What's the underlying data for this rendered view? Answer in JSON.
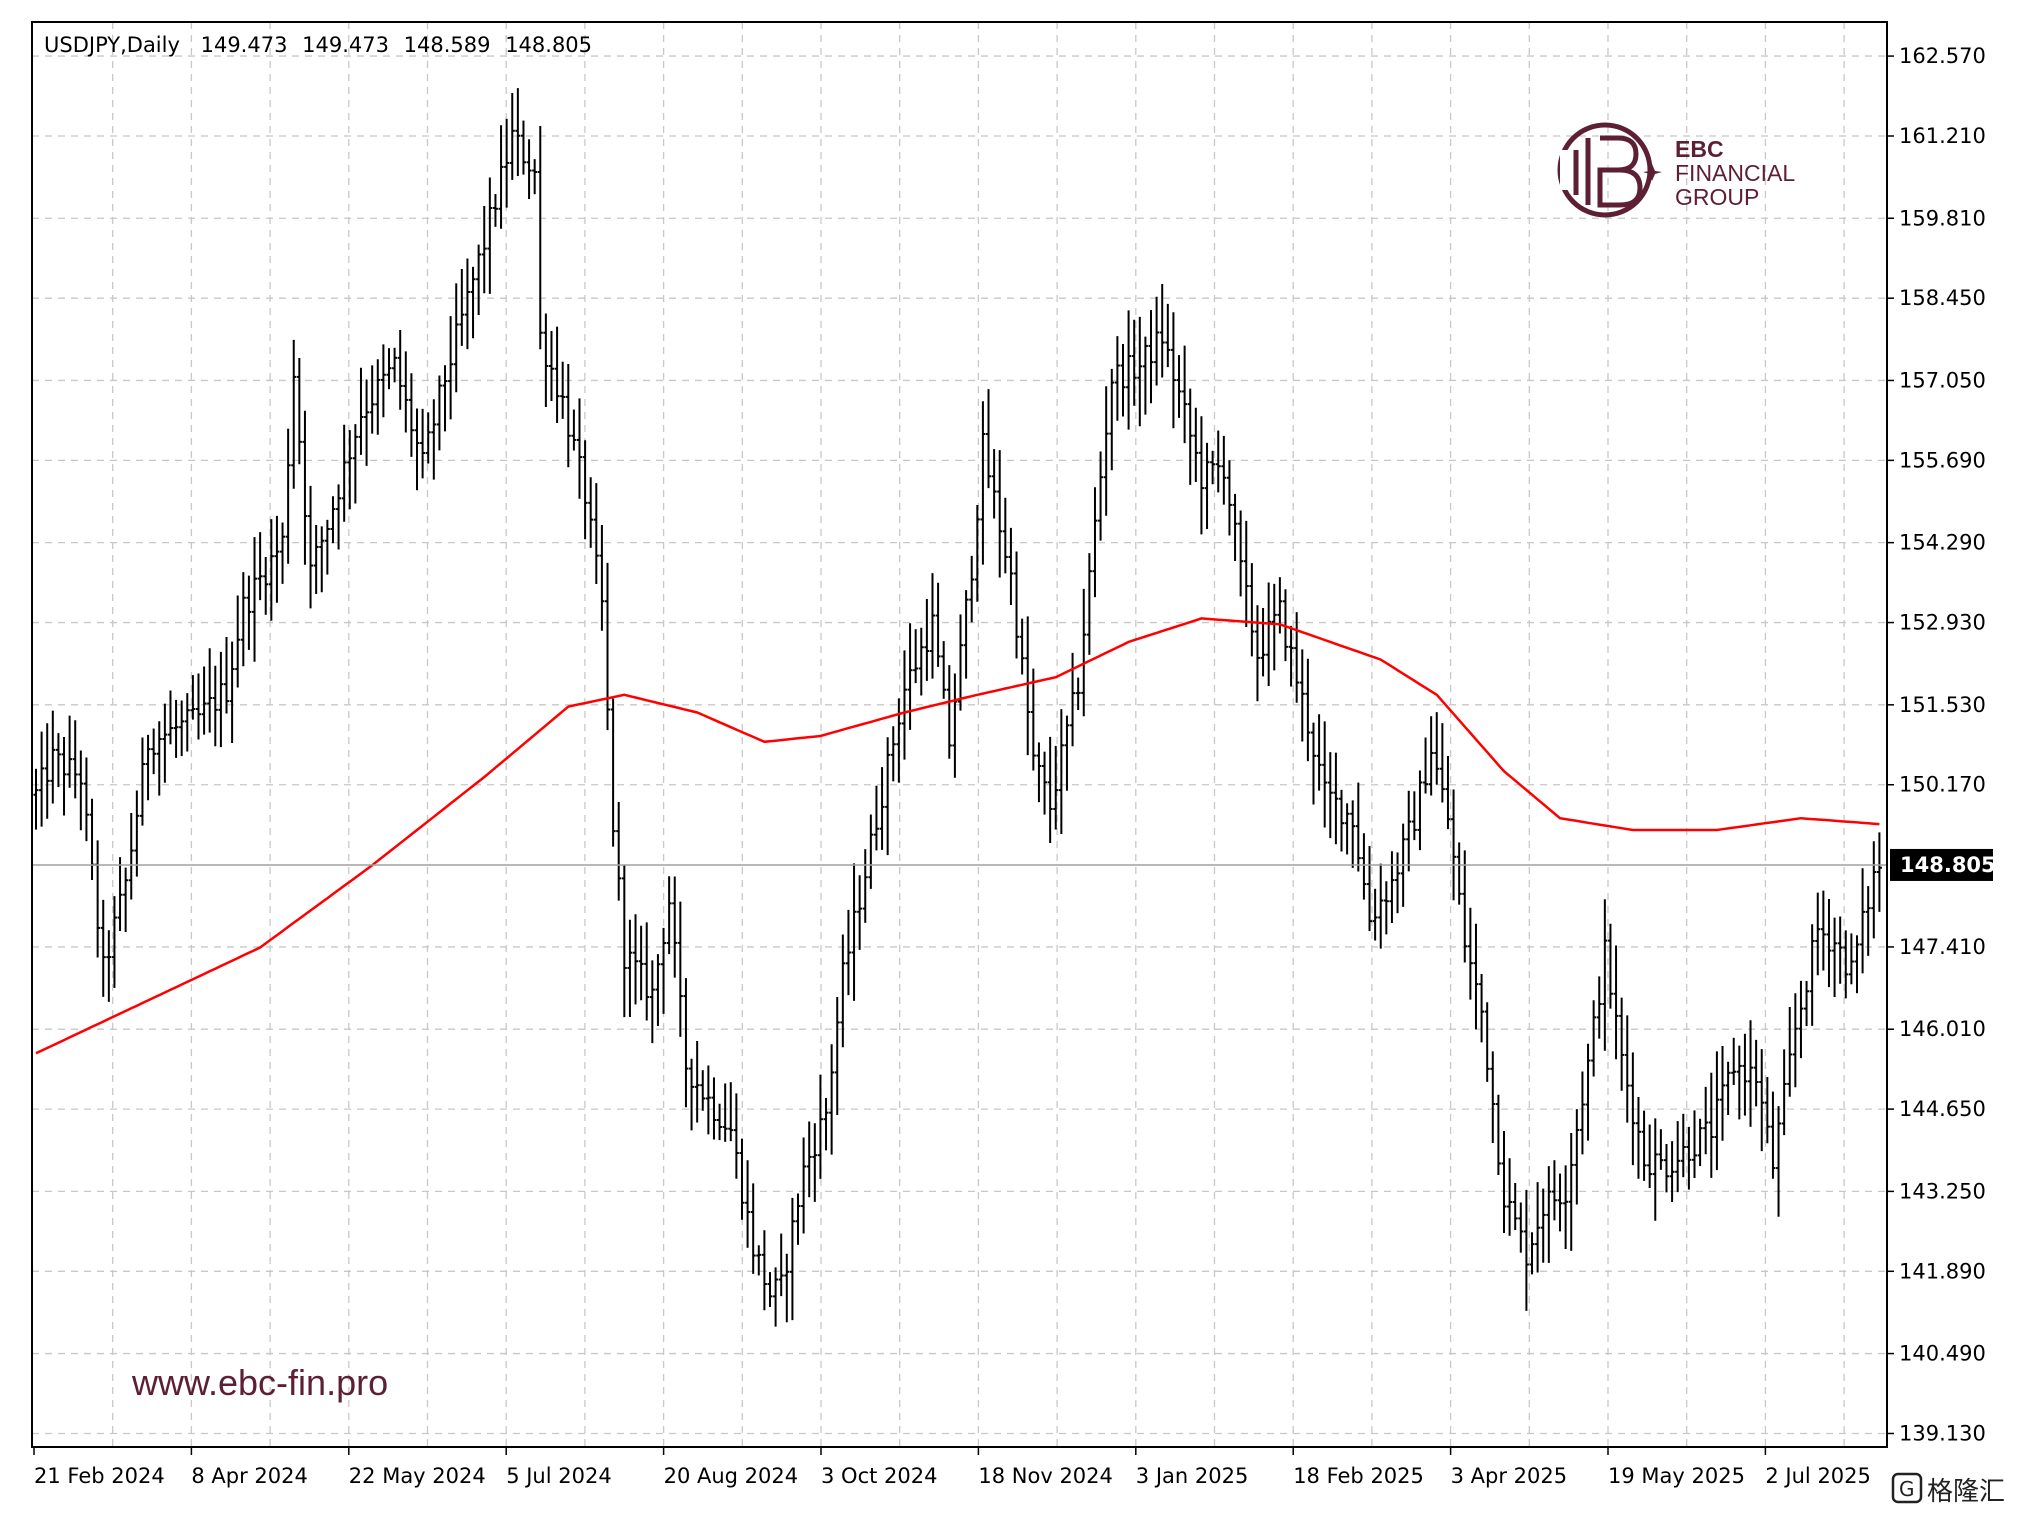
{
  "chart_data": {
    "type": "ohlc",
    "symbol_header": "USDJPY,Daily",
    "header_ohlc": [
      "149.473",
      "149.473",
      "148.589",
      "148.805"
    ],
    "last_price": "148.805",
    "y_ticks": [
      "162.570",
      "161.210",
      "159.810",
      "158.450",
      "157.050",
      "155.690",
      "154.290",
      "152.930",
      "151.530",
      "150.170",
      "147.410",
      "146.010",
      "144.650",
      "143.250",
      "141.890",
      "140.490",
      "139.130"
    ],
    "x_ticks": [
      "21 Feb 2024",
      "8 Apr 2024",
      "22 May 2024",
      "5 Jul 2024",
      "20 Aug 2024",
      "3 Oct 2024",
      "18 Nov 2024",
      "3 Jan 2025",
      "18 Feb 2025",
      "3 Apr 2025",
      "19 May 2025",
      "2 Jul 2025"
    ],
    "ylim": [
      138.9,
      163.15
    ],
    "grid": true,
    "series": [
      {
        "name": "",
        "color": "#000000",
        "kind": "bars"
      },
      {
        "name": "",
        "color": "#ff0000",
        "kind": "moving-average"
      }
    ],
    "price_path": [
      [
        0,
        150.0
      ],
      [
        3,
        150.6
      ],
      [
        8,
        150.3
      ],
      [
        12,
        147.0
      ],
      [
        16,
        148.5
      ],
      [
        20,
        150.9
      ],
      [
        29,
        151.3
      ],
      [
        34,
        151.8
      ],
      [
        37,
        153.2
      ],
      [
        44,
        154.3
      ],
      [
        46,
        157.2
      ],
      [
        49,
        153.8
      ],
      [
        52,
        154.6
      ],
      [
        58,
        156.5
      ],
      [
        64,
        157.3
      ],
      [
        69,
        155.6
      ],
      [
        73,
        157.1
      ],
      [
        80,
        159.4
      ],
      [
        85,
        161.2
      ],
      [
        89,
        160.6
      ],
      [
        90,
        157.8
      ],
      [
        94,
        156.7
      ],
      [
        98,
        155.1
      ],
      [
        101,
        153.2
      ],
      [
        103,
        149.5
      ],
      [
        105,
        147.3
      ],
      [
        110,
        146.6
      ],
      [
        113,
        148.2
      ],
      [
        116,
        145.4
      ],
      [
        120,
        144.8
      ],
      [
        124,
        144.3
      ],
      [
        128,
        142.3
      ],
      [
        131,
        141.5
      ],
      [
        133,
        141.6
      ],
      [
        137,
        143.6
      ],
      [
        141,
        144.6
      ],
      [
        144,
        146.9
      ],
      [
        150,
        149.6
      ],
      [
        155,
        151.8
      ],
      [
        160,
        152.9
      ],
      [
        163,
        150.9
      ],
      [
        167,
        153.9
      ],
      [
        169,
        155.9
      ],
      [
        174,
        153.7
      ],
      [
        178,
        150.6
      ],
      [
        181,
        149.8
      ],
      [
        186,
        151.9
      ],
      [
        189,
        154.6
      ],
      [
        192,
        157.1
      ],
      [
        197,
        157.3
      ],
      [
        201,
        157.8
      ],
      [
        204,
        156.8
      ],
      [
        208,
        155.4
      ],
      [
        212,
        155.6
      ],
      [
        215,
        153.8
      ],
      [
        218,
        152.4
      ],
      [
        222,
        153.1
      ],
      [
        226,
        151.6
      ],
      [
        230,
        150.0
      ],
      [
        235,
        149.6
      ],
      [
        238,
        147.9
      ],
      [
        242,
        148.5
      ],
      [
        246,
        149.6
      ],
      [
        249,
        150.8
      ],
      [
        252,
        149.6
      ],
      [
        255,
        147.5
      ],
      [
        258,
        146.3
      ],
      [
        262,
        143.2
      ],
      [
        266,
        142.2
      ],
      [
        269,
        143.0
      ],
      [
        273,
        143.3
      ],
      [
        277,
        145.4
      ],
      [
        280,
        147.3
      ],
      [
        283,
        145.5
      ],
      [
        287,
        143.8
      ],
      [
        291,
        143.7
      ],
      [
        295,
        144.0
      ],
      [
        299,
        144.3
      ],
      [
        303,
        145.4
      ],
      [
        307,
        145.2
      ],
      [
        310,
        143.7
      ],
      [
        314,
        146.0
      ],
      [
        318,
        147.7
      ],
      [
        321,
        147.5
      ],
      [
        324,
        147.0
      ],
      [
        328,
        148.6
      ],
      [
        329,
        148.805
      ]
    ],
    "ma_path": [
      [
        0,
        145.6
      ],
      [
        20,
        146.5
      ],
      [
        40,
        147.4
      ],
      [
        60,
        148.8
      ],
      [
        80,
        150.3
      ],
      [
        95,
        151.5
      ],
      [
        105,
        151.7
      ],
      [
        118,
        151.4
      ],
      [
        130,
        150.9
      ],
      [
        140,
        151.0
      ],
      [
        155,
        151.4
      ],
      [
        168,
        151.7
      ],
      [
        182,
        152.0
      ],
      [
        195,
        152.6
      ],
      [
        208,
        153.0
      ],
      [
        222,
        152.9
      ],
      [
        240,
        152.3
      ],
      [
        250,
        151.7
      ],
      [
        262,
        150.4
      ],
      [
        272,
        149.6
      ],
      [
        285,
        149.4
      ],
      [
        300,
        149.4
      ],
      [
        315,
        149.6
      ],
      [
        329,
        149.5
      ]
    ]
  },
  "branding": {
    "logo_line1": "EBC",
    "logo_line2": "FINANCIAL",
    "logo_line3": "GROUP",
    "url": "www.ebc-fin.pro",
    "corner_mark": "格隆汇"
  }
}
